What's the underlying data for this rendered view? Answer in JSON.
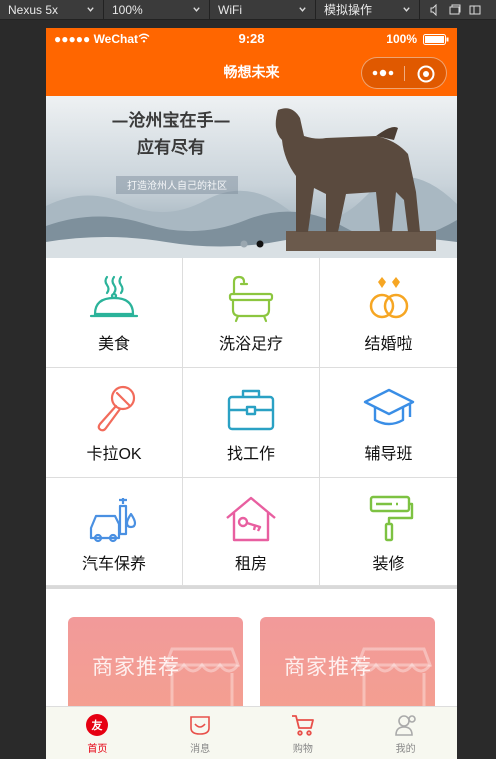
{
  "devtools": {
    "device": "Nexus 5x",
    "zoom": "100%",
    "network": "WiFi",
    "operation": "模拟操作"
  },
  "statusbar": {
    "carrier": "●●●●● WeChat",
    "time": "9:28",
    "battery": "100%",
    "battery_level": 1.0
  },
  "navbar": {
    "title": "畅想未来"
  },
  "banner": {
    "headline": "—沧州宝在手—",
    "subline": "应有尽有",
    "tagline": "打造沧州人自己的社区",
    "slide_count": 2,
    "active_slide": 2
  },
  "categories": [
    {
      "label": "美食",
      "icon": "food-cloche-icon",
      "color": "#2bb39a"
    },
    {
      "label": "洗浴足疗",
      "icon": "bathtub-icon",
      "color": "#8cc63f"
    },
    {
      "label": "结婚啦",
      "icon": "wedding-rings-icon",
      "color": "#f6a623"
    },
    {
      "label": "卡拉OK",
      "icon": "microphone-icon",
      "color": "#f26b5b"
    },
    {
      "label": "找工作",
      "icon": "briefcase-icon",
      "color": "#2aa1c4"
    },
    {
      "label": "辅导班",
      "icon": "graduation-cap-icon",
      "color": "#3a8ee6"
    },
    {
      "label": "汽车保养",
      "icon": "car-wash-icon",
      "color": "#4a90e2"
    },
    {
      "label": "租房",
      "icon": "house-key-icon",
      "color": "#e85fa0"
    },
    {
      "label": "装修",
      "icon": "paint-roller-icon",
      "color": "#7dc242"
    }
  ],
  "promo": {
    "cards": [
      {
        "label": "商家推荐"
      },
      {
        "label": "商家推荐"
      }
    ]
  },
  "tabbar": {
    "items": [
      {
        "label": "首页",
        "icon": "home-friend-icon",
        "active": true
      },
      {
        "label": "消息",
        "icon": "message-smile-icon",
        "active": false
      },
      {
        "label": "购物",
        "icon": "shopping-cart-icon",
        "active": false
      },
      {
        "label": "我的",
        "icon": "profile-icon",
        "active": false
      }
    ]
  },
  "colors": {
    "brand": "#ff6600",
    "tab_active": "#e60012",
    "promo_card": "#f29a9a"
  }
}
